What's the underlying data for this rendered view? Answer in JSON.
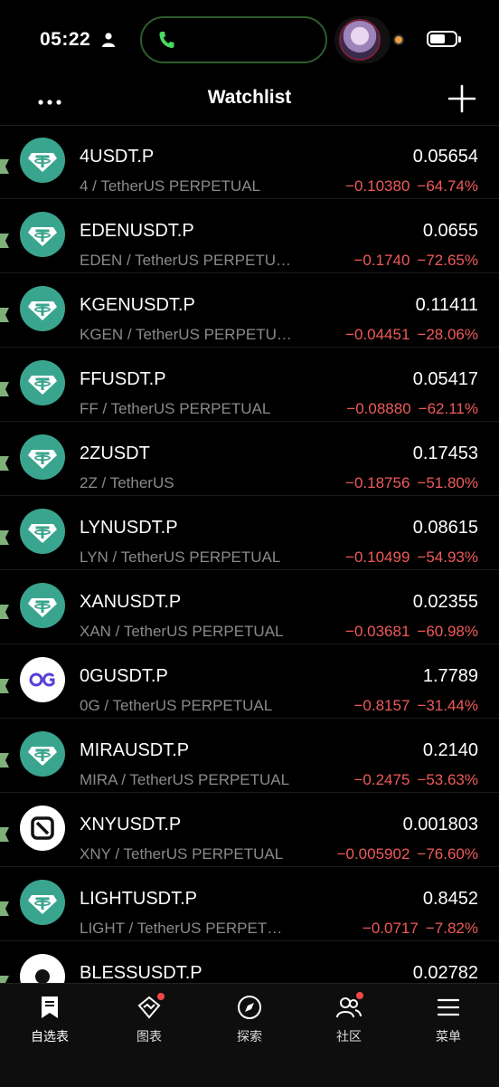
{
  "status_bar": {
    "time": "05:22",
    "battery_level": 0.6
  },
  "header": {
    "title": "Watchlist"
  },
  "colors": {
    "background": "#000000",
    "negative": "#ef5a5a",
    "tether_green": "#3aa58f",
    "flag_green": "#7fb07a"
  },
  "watchlist": [
    {
      "symbol": "4USDT.P",
      "subtitle": "4 / TetherUS PERPETUAL",
      "price": "0.05654",
      "change": "−0.10380",
      "change_pct": "−64.74%",
      "icon": "tether-icon"
    },
    {
      "symbol": "EDENUSDT.P",
      "subtitle": "EDEN / TetherUS PERPETUAL",
      "price": "0.0655",
      "change": "−0.1740",
      "change_pct": "−72.65%",
      "icon": "tether-icon"
    },
    {
      "symbol": "KGENUSDT.P",
      "subtitle": "KGEN / TetherUS PERPETUAL",
      "price": "0.11411",
      "change": "−0.04451",
      "change_pct": "−28.06%",
      "icon": "tether-icon"
    },
    {
      "symbol": "FFUSDT.P",
      "subtitle": "FF / TetherUS PERPETUAL",
      "price": "0.05417",
      "change": "−0.08880",
      "change_pct": "−62.11%",
      "icon": "tether-icon"
    },
    {
      "symbol": "2ZUSDT",
      "subtitle": "2Z / TetherUS",
      "price": "0.17453",
      "change": "−0.18756",
      "change_pct": "−51.80%",
      "icon": "tether-icon"
    },
    {
      "symbol": "LYNUSDT.P",
      "subtitle": "LYN / TetherUS PERPETUAL",
      "price": "0.08615",
      "change": "−0.10499",
      "change_pct": "−54.93%",
      "icon": "tether-icon"
    },
    {
      "symbol": "XANUSDT.P",
      "subtitle": "XAN / TetherUS PERPETUAL",
      "price": "0.02355",
      "change": "−0.03681",
      "change_pct": "−60.98%",
      "icon": "tether-icon"
    },
    {
      "symbol": "0GUSDT.P",
      "subtitle": "0G / TetherUS PERPETUAL",
      "price": "1.7789",
      "change": "−0.8157",
      "change_pct": "−31.44%",
      "icon": "0g-icon"
    },
    {
      "symbol": "MIRAUSDT.P",
      "subtitle": "MIRA / TetherUS PERPETUAL",
      "price": "0.2140",
      "change": "−0.2475",
      "change_pct": "−53.63%",
      "icon": "tether-icon"
    },
    {
      "symbol": "XNYUSDT.P",
      "subtitle": "XNY / TetherUS PERPETUAL",
      "price": "0.001803",
      "change": "−0.005902",
      "change_pct": "−76.60%",
      "icon": "xny-icon"
    },
    {
      "symbol": "LIGHTUSDT.P",
      "subtitle": "LIGHT / TetherUS PERPETUAL",
      "price": "0.8452",
      "change": "−0.0717",
      "change_pct": "−7.82%",
      "icon": "tether-icon"
    },
    {
      "symbol": "BLESSUSDT.P",
      "subtitle": "",
      "price": "0.02782",
      "change": "",
      "change_pct": "",
      "icon": "bless-icon"
    }
  ],
  "tabbar": {
    "tabs": [
      {
        "label": "自选表",
        "icon": "watchlist-icon",
        "active": true
      },
      {
        "label": "图表",
        "icon": "chart-icon",
        "badge": true
      },
      {
        "label": "探索",
        "icon": "compass-icon"
      },
      {
        "label": "社区",
        "icon": "community-icon",
        "badge": true
      },
      {
        "label": "菜单",
        "icon": "menu-icon"
      }
    ]
  }
}
